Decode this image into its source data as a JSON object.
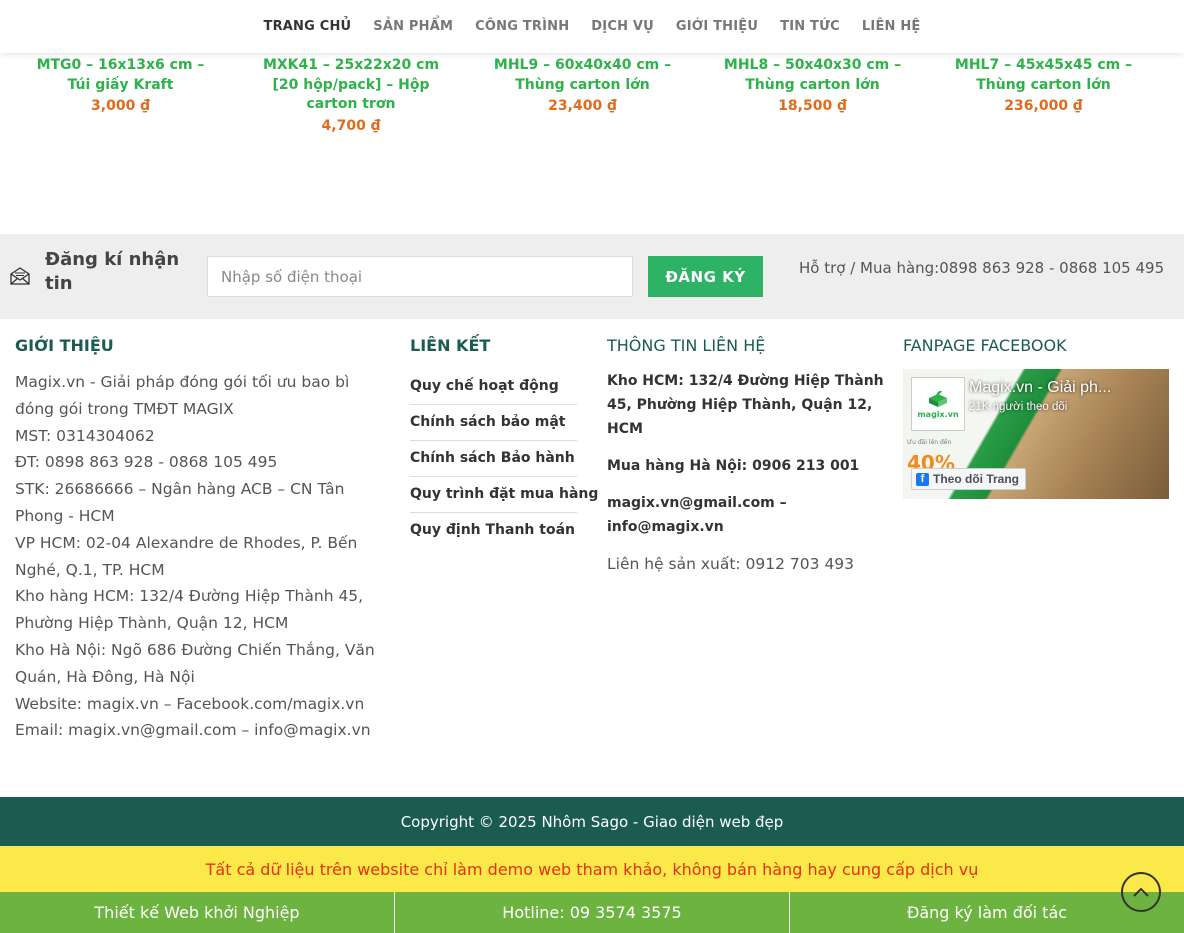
{
  "nav": {
    "items": [
      "TRANG CHỦ",
      "SẢN PHẨM",
      "CÔNG TRÌNH",
      "DỊCH VỤ",
      "GIỚI THIỆU",
      "TIN TỨC",
      "LIÊN HỆ"
    ]
  },
  "products": [
    {
      "name": "MTG0 – 16x13x6 cm – Túi giấy Kraft",
      "price": "3,000 ₫"
    },
    {
      "name": "MXK41 – 25x22x20 cm [20 hộp/pack] – Hộp carton trơn",
      "price": "4,700 ₫"
    },
    {
      "name": "MHL9 – 60x40x40 cm – Thùng carton lớn",
      "price": "23,400 ₫"
    },
    {
      "name": "MHL8 – 50x40x30 cm – Thùng carton lớn",
      "price": "18,500 ₫"
    },
    {
      "name": "MHL7 – 45x45x45 cm – Thùng carton lớn",
      "price": "236,000 ₫"
    }
  ],
  "newsletter": {
    "title": "Đăng kí nhận tin",
    "placeholder": "Nhập số điện thoại",
    "button": "ĐĂNG KÝ",
    "support": "Hỗ trợ / Mua hàng:0898 863 928 - 0868 105 495"
  },
  "footer": {
    "about_title": "GIỚI THIỆU",
    "about_lines": [
      "Magix.vn - Giải pháp đóng gói tối ưu bao bì đóng gói trong TMĐT MAGIX",
      "MST: 0314304062",
      "ĐT: 0898 863 928 - 0868 105 495",
      "STK: 26686666 – Ngân hàng ACB – CN Tân Phong - HCM",
      "VP HCM: 02-04 Alexandre de Rhodes, P. Bến Nghé, Q.1, TP. HCM",
      "Kho hàng HCM: 132/4 Đường Hiệp Thành 45, Phường Hiệp Thành, Quận 12, HCM",
      "Kho Hà Nội: Ngõ 686 Đường Chiến Thắng, Văn Quán, Hà Đông, Hà Nội",
      "Website: magix.vn – Facebook.com/magix.vn",
      "Email: magix.vn@gmail.com – info@magix.vn"
    ],
    "links_title": "LIÊN KẾT",
    "links": [
      "Quy chế hoạt động",
      "Chính sách bảo mật",
      "Chính sách Bảo hành",
      "Quy trình đặt mua hàng",
      "Quy định Thanh toán"
    ],
    "contact_title": "THÔNG TIN LIÊN HỆ",
    "contact_bold": [
      "Kho HCM: 132/4 Đường Hiệp Thành 45, Phường Hiệp Thành, Quận 12, HCM",
      "Mua hàng Hà Nội: 0906 213 001",
      "magix.vn@gmail.com – info@magix.vn"
    ],
    "contact_normal": "Liên hệ sản xuất: 0912 703 493",
    "fanpage_title": "FANPAGE FACEBOOK",
    "fanpage": {
      "name": "Magix.vn - Giải ph...",
      "followers": "21K người theo dõi",
      "logo_text": "magix.vn",
      "promo_small": "Ưu đãi lên đến",
      "promo_pct": "40%",
      "follow_button": "Theo dõi Trang"
    }
  },
  "copyright": "Copyright © 2025 Nhôm Sago - Giao diện web đẹp",
  "demo_notice": "Tất cả dữ liệu trên website chỉ làm demo web tham khảo, không bán hàng hay cung cấp dịch vụ",
  "bottom_bar": [
    "Thiết kế Web khởi Nghiệp",
    "Hotline: 09 3574 3575",
    "Đăng ký làm đối tác"
  ],
  "colors": {
    "brand_green": "#2eb24a",
    "price_orange": "#e26a1b",
    "footer_dark_green": "#1a5b52",
    "demo_yellow": "#fbe94a",
    "bottom_green": "#6db33f"
  }
}
